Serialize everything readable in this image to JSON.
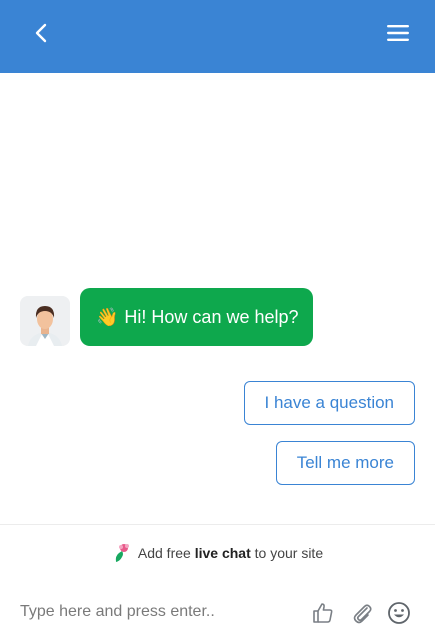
{
  "header": {
    "back_icon": "chevron-left-icon",
    "menu_icon": "hamburger-menu-icon",
    "background_color": "#3a84d4"
  },
  "conversation": {
    "agent_avatar": "agent-avatar",
    "greeting_emoji": "👋",
    "greeting_text": "Hi! How can we help?",
    "bubble_color": "#0ea84d"
  },
  "quick_replies": [
    {
      "label": "I have a question"
    },
    {
      "label": "Tell me more"
    }
  ],
  "promo": {
    "prefix": "Add free",
    "bold": "live chat",
    "suffix": "to your site",
    "logo_icon": "tidio-logo-icon"
  },
  "composer": {
    "placeholder": "Type here and press enter..",
    "icons": [
      "thumbs-up-icon",
      "paperclip-icon",
      "emoji-icon"
    ]
  }
}
